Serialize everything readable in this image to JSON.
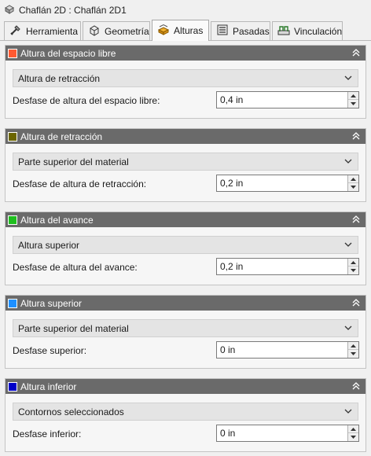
{
  "window": {
    "title": "Chaflán 2D : Chaflán 2D1"
  },
  "tabs": [
    {
      "label": "Herramienta",
      "icon": "tool-icon",
      "active": false
    },
    {
      "label": "Geometría",
      "icon": "geometry-icon",
      "active": false
    },
    {
      "label": "Alturas",
      "icon": "heights-icon",
      "active": true
    },
    {
      "label": "Pasadas",
      "icon": "passes-icon",
      "active": false
    },
    {
      "label": "Vinculación",
      "icon": "linking-icon",
      "active": false
    }
  ],
  "sections": [
    {
      "title": "Altura del espacio libre",
      "color": "#ff5a32",
      "dropdown": "Altura de retracción",
      "field_label": "Desfase de altura del espacio libre:",
      "value": "0,4 in"
    },
    {
      "title": "Altura de retracción",
      "color": "#6b6500",
      "dropdown": "Parte superior del material",
      "field_label": "Desfase de altura de retracción:",
      "value": "0,2 in"
    },
    {
      "title": "Altura del avance",
      "color": "#1fbf1f",
      "dropdown": "Altura superior",
      "field_label": "Desfase de altura del avance:",
      "value": "0,2 in"
    },
    {
      "title": "Altura superior",
      "color": "#1e90ff",
      "dropdown": "Parte superior del material",
      "field_label": "Desfase superior:",
      "value": "0 in"
    },
    {
      "title": "Altura inferior",
      "color": "#0000c8",
      "dropdown": "Contornos seleccionados",
      "field_label": "Desfase inferior:",
      "value": "0 in"
    }
  ]
}
